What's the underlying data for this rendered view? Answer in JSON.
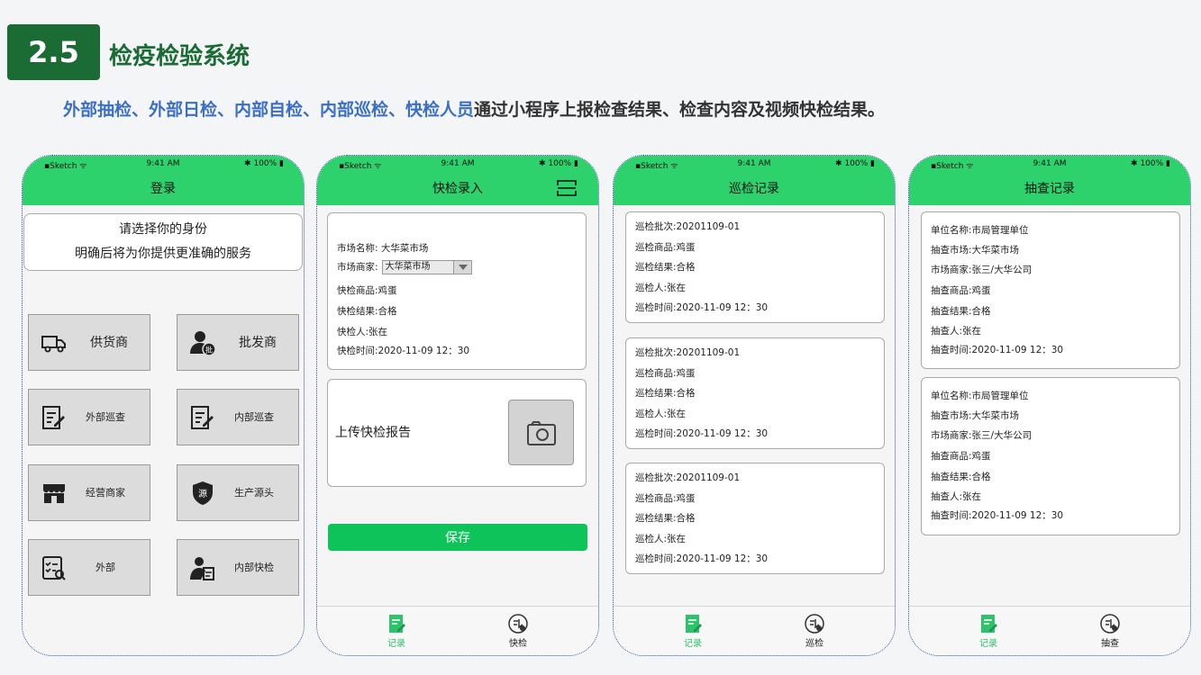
{
  "header": {
    "badge": "2.5",
    "title": "检疫检验系统",
    "headline_highlight": "外部抽检、外部日检、内部自检、内部巡检、快检人员",
    "headline_rest": "通过小程序上报检查结果、检查内容及视频快检结果。"
  },
  "status_bar": {
    "carrier": "Sketch",
    "time": "9:41 AM",
    "battery": "100%"
  },
  "login": {
    "nav_title": "登录",
    "prompt_line1": "请选择你的身份",
    "prompt_line2": "明确后将为你提供更准确的服务",
    "roles": [
      {
        "label": "供货商",
        "icon": "truck-icon"
      },
      {
        "label": "批发商",
        "icon": "wholesaler-icon"
      },
      {
        "label": "外部巡查",
        "icon": "edit-doc-icon"
      },
      {
        "label": "内部巡查",
        "icon": "edit-doc-icon"
      },
      {
        "label": "经营商家",
        "icon": "store-icon"
      },
      {
        "label": "生产源头",
        "icon": "shield-icon"
      },
      {
        "label": "外部",
        "icon": "checklist-icon"
      },
      {
        "label": "内部快检",
        "icon": "inspector-icon"
      }
    ],
    "shield_glyph": "源",
    "wholesaler_glyph": "批"
  },
  "quick_entry": {
    "nav_title": "快检录入",
    "market_name": "市场名称:  大华菜市场",
    "merchant_label": "市场商家:",
    "merchant_value": "大华菜市场",
    "product": "快检商品:鸡蛋",
    "result": "快检结果:合格",
    "person": "快检人:张在",
    "time": "快检时间:2020-11-09 12：30",
    "upload_label": "上传快检报告",
    "save_label": "保存",
    "tabs": [
      "记录",
      "快检"
    ]
  },
  "patrol": {
    "nav_title": "巡检记录",
    "records": [
      [
        "巡检批次:20201109-01",
        "巡检商品:鸡蛋",
        "巡检结果:合格",
        "巡检人:张在",
        "巡检时间:2020-11-09 12：30"
      ],
      [
        "巡检批次:20201109-01",
        "巡检商品:鸡蛋",
        "巡检结果:合格",
        "巡检人:张在",
        "巡检时间:2020-11-09 12：30"
      ],
      [
        "巡检批次:20201109-01",
        "巡检商品:鸡蛋",
        "巡检结果:合格",
        "巡检人:张在",
        "巡检时间:2020-11-09 12：30"
      ]
    ],
    "tabs": [
      "记录",
      "巡检"
    ]
  },
  "spot_check": {
    "nav_title": "抽查记录",
    "records": [
      [
        "单位名称:市局管理单位",
        "抽查市场:大华菜市场",
        "市场商家:张三/大华公司",
        "抽查商品:鸡蛋",
        "抽查结果:合格",
        "抽查人:张在",
        "抽查时间:2020-11-09 12：30"
      ],
      [
        "单位名称:市局管理单位",
        "抽查市场:大华菜市场",
        "市场商家:张三/大华公司",
        "抽查商品:鸡蛋",
        "抽查结果:合格",
        "抽查人:张在",
        "抽查时间:2020-11-09 12：30"
      ]
    ],
    "tabs": [
      "记录",
      "抽查"
    ]
  },
  "colors": {
    "brand_green": "#1a6b34",
    "nav_green": "#2ed26d",
    "highlight_blue": "#3b6fc4",
    "save_green": "#0ec45a"
  }
}
